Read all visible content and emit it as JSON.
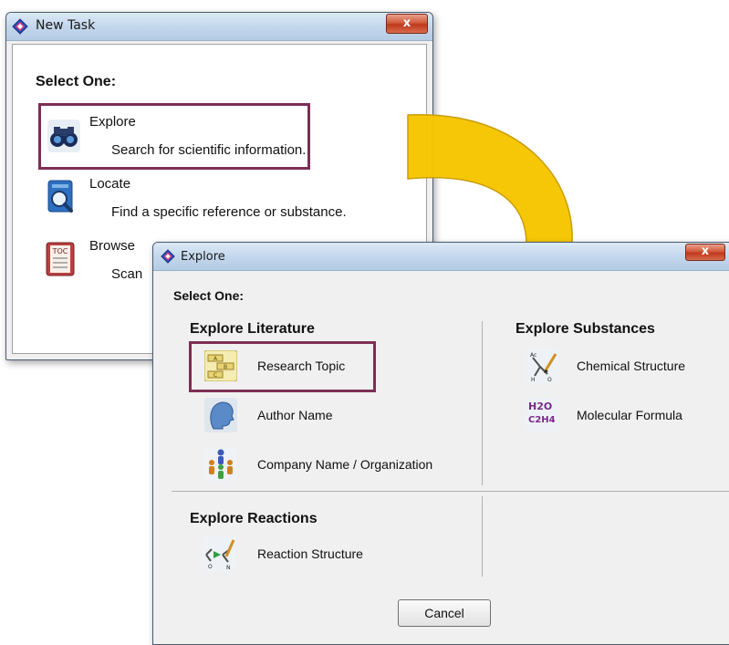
{
  "new_task_window": {
    "title": "New Task",
    "close_label": "x",
    "heading": "Select One:",
    "items": [
      {
        "label": "Explore",
        "description": "Search for scientific information.",
        "icon": "binoculars-icon"
      },
      {
        "label": "Locate",
        "description": "Find a specific reference or substance.",
        "icon": "magnifier-document-icon"
      },
      {
        "label": "Browse",
        "description": "Scan",
        "icon": "toc-book-icon"
      }
    ]
  },
  "explore_window": {
    "title": "Explore",
    "close_label": "x",
    "heading": "Select One:",
    "sections": {
      "literature": {
        "title": "Explore Literature",
        "items": [
          {
            "label": "Research Topic",
            "icon": "research-topic-icon"
          },
          {
            "label": "Author Name",
            "icon": "author-head-icon"
          },
          {
            "label": "Company Name / Organization",
            "icon": "organization-people-icon"
          }
        ]
      },
      "substances": {
        "title": "Explore Substances",
        "items": [
          {
            "label": "Chemical Structure",
            "icon": "chemical-structure-icon"
          },
          {
            "label": "Molecular Formula",
            "icon": "molecular-formula-icon",
            "glyph_top": "H2O",
            "glyph_bottom": "C2H4"
          }
        ]
      },
      "reactions": {
        "title": "Explore Reactions",
        "items": [
          {
            "label": "Reaction Structure",
            "icon": "reaction-structure-icon"
          }
        ]
      }
    },
    "cancel_label": "Cancel"
  },
  "colors": {
    "highlight": "#7b2f55",
    "arrow_fill": "#f6c600",
    "arrow_stroke": "#c89a00"
  }
}
